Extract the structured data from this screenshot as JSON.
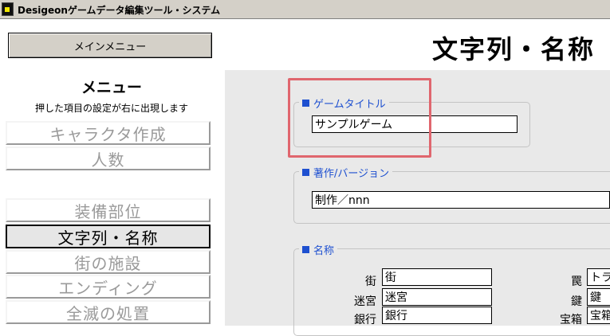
{
  "window": {
    "title": "Desigeonゲームデータ編集ツール・システム"
  },
  "sidebar": {
    "main_menu_button": "メインメニュー",
    "heading": "メニュー",
    "subheading": "押した項目の設定が右に出現します",
    "items": [
      {
        "label": "キャラクタ作成"
      },
      {
        "label": "人数"
      },
      {
        "label": "装備部位"
      },
      {
        "label": "文字列・名称",
        "active": true
      },
      {
        "label": "街の施設"
      },
      {
        "label": "エンディング"
      },
      {
        "label": "全滅の処置"
      }
    ]
  },
  "main": {
    "title": "文字列・名称",
    "game_title": {
      "legend": "ゲームタイトル",
      "value": "サンプルゲーム"
    },
    "copyright": {
      "legend": "著作/バージョン",
      "value": "制作／nnn"
    },
    "names": {
      "legend": "名称",
      "left": [
        {
          "label": "街",
          "value": "街"
        },
        {
          "label": "迷宮",
          "value": "迷宮"
        },
        {
          "label": "銀行",
          "value": "銀行"
        }
      ],
      "right": [
        {
          "label": "罠",
          "value": "トラ"
        },
        {
          "label": "鍵",
          "value": "鍵"
        },
        {
          "label": "宝箱",
          "value": "宝箱"
        }
      ]
    }
  },
  "colors": {
    "legend_blue": "#1e50d0",
    "highlight": "#e0666e",
    "panel": "#e9e9e9",
    "chrome": "#d4d0c8"
  }
}
